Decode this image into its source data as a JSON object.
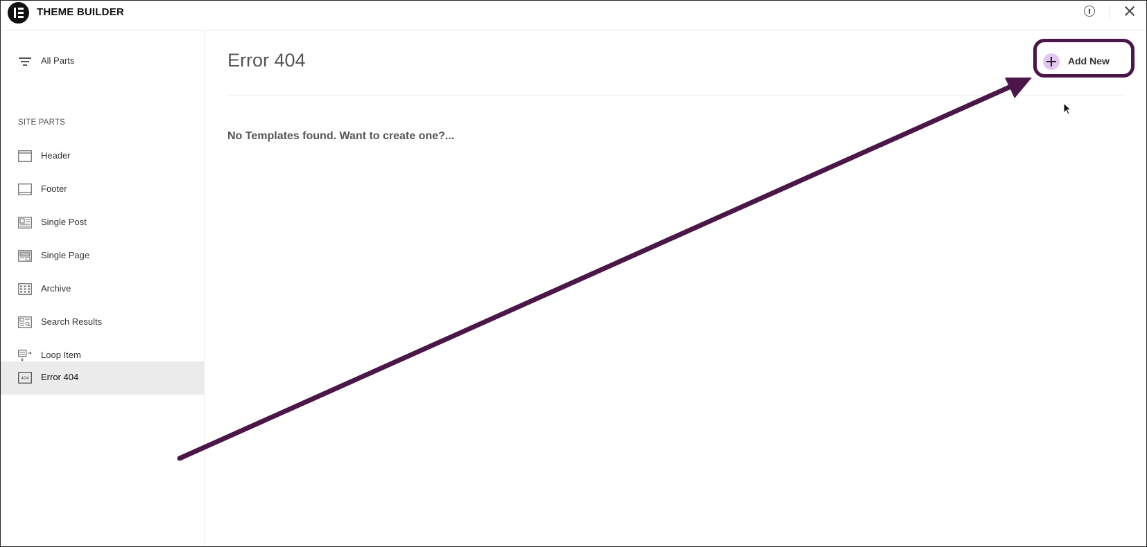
{
  "app": {
    "title": "THEME BUILDER",
    "logo_icon": "elementor-logo-icon"
  },
  "topbar": {
    "help_icon": "help-upload-icon",
    "close_icon": "close-icon"
  },
  "sidebar": {
    "all_parts_label": "All Parts",
    "section_title": "SITE PARTS",
    "items": [
      {
        "label": "Header",
        "icon": "header-icon"
      },
      {
        "label": "Footer",
        "icon": "footer-icon"
      },
      {
        "label": "Single Post",
        "icon": "single-post-icon"
      },
      {
        "label": "Single Page",
        "icon": "single-page-icon"
      },
      {
        "label": "Archive",
        "icon": "archive-icon"
      },
      {
        "label": "Search Results",
        "icon": "search-results-icon"
      },
      {
        "label": "Loop Item",
        "icon": "loop-item-icon"
      },
      {
        "label": "Error 404",
        "icon": "error-404-icon",
        "active": true
      }
    ]
  },
  "main": {
    "title": "Error 404",
    "add_new_label": "Add New",
    "empty_message": "No Templates found. Want to create one?...",
    "error_icon_text": "404"
  },
  "colors": {
    "annotation": "#4b1648",
    "plus_circle": "#e3c6ef",
    "active_item_bg": "#ebebeb"
  }
}
